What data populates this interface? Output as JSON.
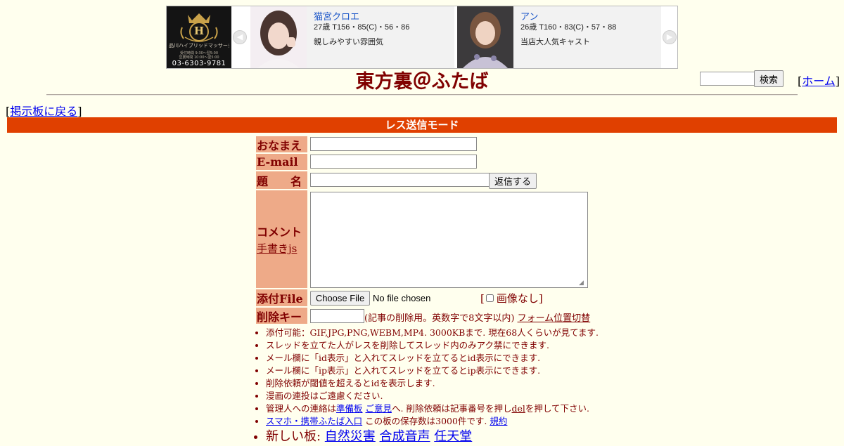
{
  "ad": {
    "logo_lines": [
      "品川ハイブリッドマッサージ",
      "受付時間 9:30〜翌5:00",
      "営業時間 10:00〜翌5:00"
    ],
    "logo_phone": "03-6303-9781",
    "prev_arrow": "◀",
    "next_arrow": "▶",
    "cards": [
      {
        "name": "猫宮クロエ",
        "stats": "27歳 T156・85(C)・56・86",
        "desc": "親しみやすい雰囲気"
      },
      {
        "name": "アン",
        "stats": "26歳 T160・83(C)・57・88",
        "desc": "当店大人気キャスト"
      }
    ]
  },
  "header": {
    "title": "東方裏＠ふたば",
    "search_button": "検索",
    "home_open": "[",
    "home_link": "ホーム",
    "home_close": "]"
  },
  "nav": {
    "back_open": "[",
    "back_link": "掲示板に戻る",
    "back_close": "]"
  },
  "mode_bar": "レス送信モード",
  "form": {
    "name_label": "おなまえ",
    "email_label": "E-mail",
    "subject_label": "題　　名",
    "reply_button": "返信する",
    "comment_label": "コメント",
    "handwriting_link": "手書きjs",
    "file_label": "添付File",
    "file_button": "Choose File",
    "file_status": "No file chosen",
    "noimage_open": "[",
    "noimage_label": "画像なし",
    "noimage_close": "]",
    "delkey_label": "削除キー",
    "delkey_note": "(記事の削除用。英数字で8文字以内)",
    "form_position_link": "フォーム位置切替"
  },
  "notes": {
    "item1": "添付可能：GIF,JPG,PNG,WEBM,MP4. 3000KBまで. 現在68人くらいが見てます.",
    "item2": "スレッドを立てた人がレスを削除してスレッド内のみアク禁にできます.",
    "item3": "メール欄に「id表示」と入れてスレッドを立てるとid表示にできます.",
    "item4": "メール欄に「ip表示」と入れてスレッドを立てるとip表示にできます.",
    "item5": "削除依頼が閾値を超えるとidを表示します.",
    "item6": "漫画の連投はご遠慮ください.",
    "item7": {
      "prefix": "管理人への連絡は",
      "link1": "準備板",
      "link2": "ご意見",
      "middle": "へ. 削除依頼は記事番号を押し",
      "del_link": "del",
      "suffix": "を押して下さい."
    },
    "item8": {
      "mobile_link": "スマホ・携帯ふたば入口",
      "middle": " この板の保存数は3000件です. ",
      "rules_link": "規約"
    },
    "item9": {
      "prefix": "新しい板: ",
      "boards": [
        "自然災害",
        "合成音声",
        "任天堂"
      ]
    }
  }
}
